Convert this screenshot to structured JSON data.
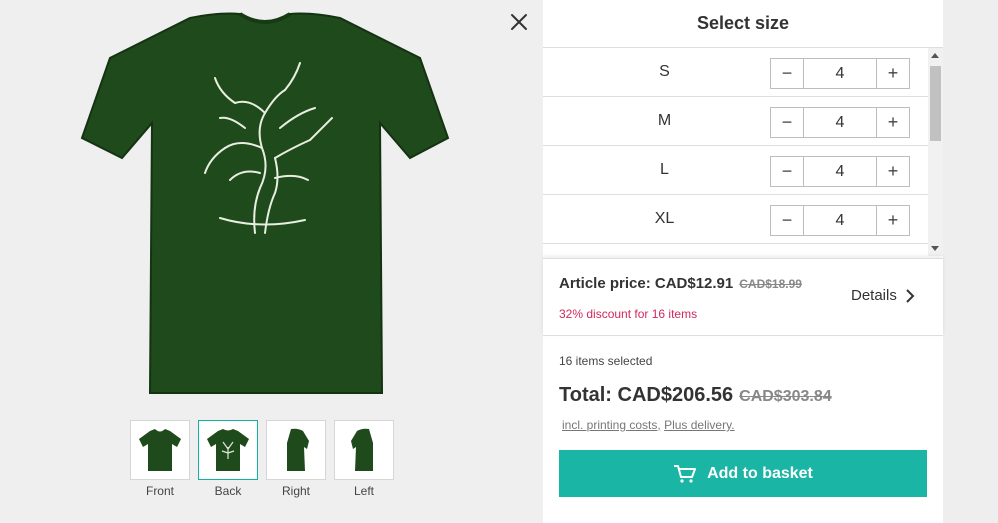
{
  "panel": {
    "title": "Select size"
  },
  "sizes": [
    {
      "label": "S",
      "qty": "4"
    },
    {
      "label": "M",
      "qty": "4"
    },
    {
      "label": "L",
      "qty": "4"
    },
    {
      "label": "XL",
      "qty": "4"
    }
  ],
  "stepper": {
    "minus": "−",
    "plus": "+"
  },
  "pricing": {
    "article_label": "Article price: CAD$12.91",
    "article_old": "CAD$18.99",
    "discount": "32% discount for 16 items",
    "details": "Details",
    "items_selected": "16 items selected",
    "total_label": "Total: CAD$206.56",
    "total_old": "CAD$303.84",
    "incl_printing": "incl. printing costs,",
    "plus_delivery": "Plus delivery."
  },
  "basket": {
    "label": "Add to basket"
  },
  "thumbnails": [
    {
      "label": "Front"
    },
    {
      "label": "Back"
    },
    {
      "label": "Right"
    },
    {
      "label": "Left"
    }
  ],
  "colors": {
    "accent": "#1bb5a5",
    "shirt": "#1f4a1c",
    "discount": "#d4275c"
  },
  "icons": {
    "close": "close-icon",
    "chevron": "chevron-right-icon",
    "cart": "cart-icon"
  }
}
